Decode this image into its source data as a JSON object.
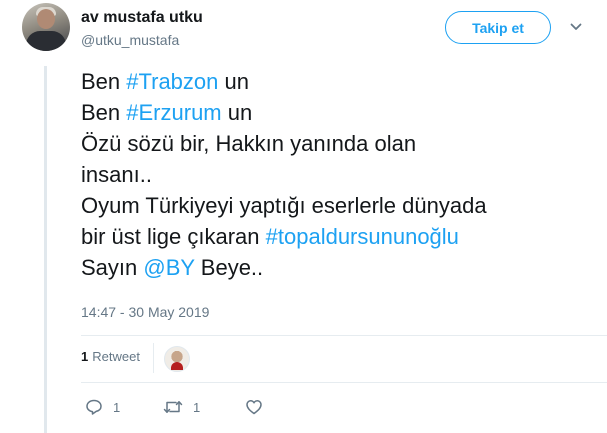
{
  "user": {
    "display_name": "av mustafa utku",
    "handle": "@utku_mustafa"
  },
  "follow_button": {
    "label": "Takip et"
  },
  "tweet": {
    "lines": [
      [
        {
          "text": "Ben "
        },
        {
          "text": "#Trabzon",
          "tag": true
        },
        {
          "text": " un"
        }
      ],
      [
        {
          "text": "Ben "
        },
        {
          "text": "#Erzurum",
          "tag": true
        },
        {
          "text": " un"
        }
      ],
      [
        {
          "text": "Özü sözü bir, Hakkın yanında olan"
        }
      ],
      [
        {
          "text": "insanı.."
        }
      ],
      [
        {
          "text": "Oyum Türkiyeyi yaptığı eserlerle dünyada"
        }
      ],
      [
        {
          "text": "bir üst lige çıkaran "
        },
        {
          "text": "#topaldursununoğlu",
          "tag": true
        }
      ],
      [
        {
          "text": "Sayın "
        },
        {
          "text": "@BY",
          "tag": true
        },
        {
          "text": " Beye.."
        }
      ]
    ],
    "timestamp": "14:47 - 30 May 2019"
  },
  "stats": {
    "retweet_count": "1",
    "retweet_label": "Retweet"
  },
  "actions": {
    "reply_count": "1",
    "retweet_count": "1"
  },
  "icons": {
    "chevron": "chevron-down-icon",
    "reply": "reply-icon",
    "retweet": "retweet-icon",
    "like": "heart-icon"
  },
  "colors": {
    "accent": "#1da1f2",
    "text": "#14171a",
    "muted": "#657786",
    "divider": "#e6ecf0"
  }
}
